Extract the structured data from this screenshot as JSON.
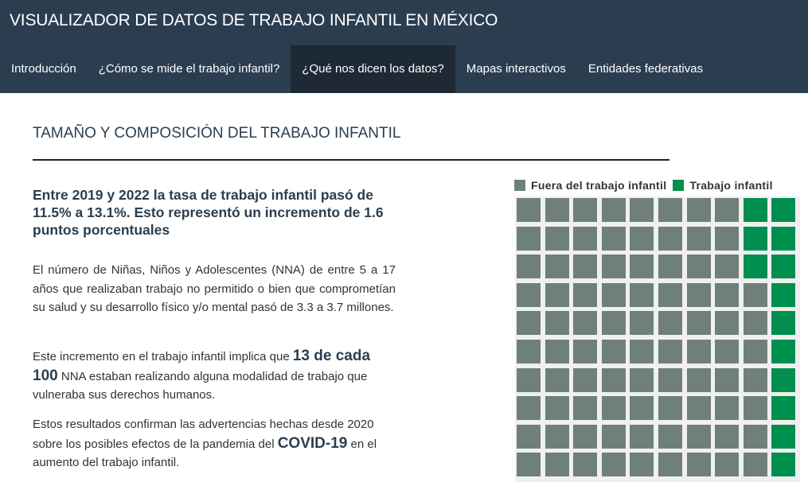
{
  "header": {
    "title": "VISUALIZADOR DE DATOS DE TRABAJO INFANTIL EN MÉXICO",
    "nav": [
      {
        "label": "Introducción",
        "active": false
      },
      {
        "label": "¿Cómo se mide el trabajo infantil?",
        "active": false
      },
      {
        "label": "¿Qué nos dicen los datos?",
        "active": true
      },
      {
        "label": "Mapas interactivos",
        "active": false
      },
      {
        "label": "Entidades federativas",
        "active": false
      }
    ]
  },
  "main": {
    "section_title": "TAMAÑO Y COMPOSICIÓN DEL TRABAJO INFANTIL",
    "headline": "Entre 2019 y 2022 la tasa de trabajo infantil pasó de 11.5% a 13.1%. Esto representó un incremento de 1.6 puntos porcentuales",
    "paragraph1": "El número de Niñas, Niños y Adolescentes (NNA) de entre 5 a 17 años que realizaban trabajo no permitido o bien que comprometían su salud y su desarrollo físico y/o mental pasó de 3.3 a 3.7 millones.",
    "paragraph2": {
      "before": "Este incremento en el trabajo infantil implica que ",
      "highlight": "13 de cada 100",
      "after": " NNA estaban realizando alguna modalidad de trabajo que vulneraba sus derechos humanos."
    },
    "paragraph3": {
      "before": "Estos resultados confirman las advertencias hechas desde 2020 sobre los posibles efectos de la pandemia del ",
      "highlight": "COVID-19",
      "after": " en el aumento del trabajo infantil."
    }
  },
  "chart_data": {
    "type": "waffle",
    "legend": [
      {
        "name": "Fuera del trabajo infantil",
        "color": "#6f8079"
      },
      {
        "name": "Trabajo infantil",
        "color": "#008f4f"
      }
    ],
    "rows": 10,
    "columns": 10,
    "total_cells": 100,
    "trabajo_infantil_cells": 13,
    "fuera_cells": 87,
    "fill_order": "column-major from right column, top to bottom"
  }
}
